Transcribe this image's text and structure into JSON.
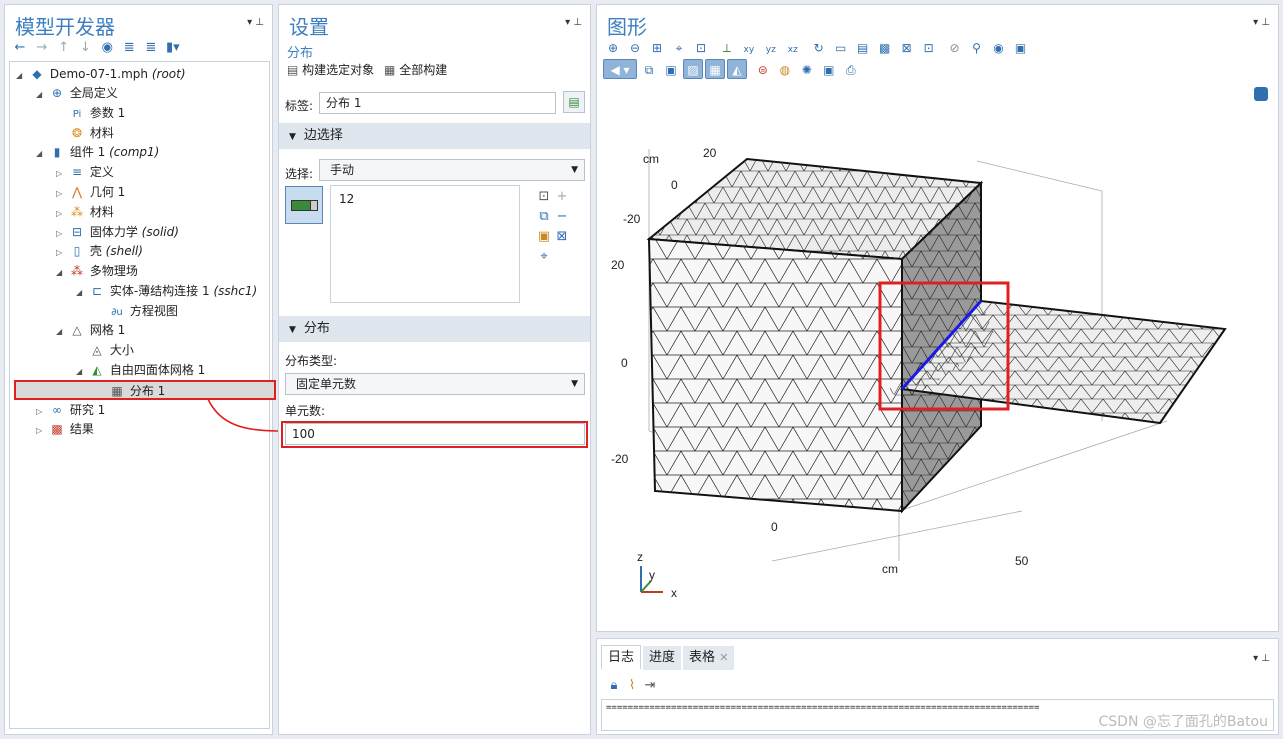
{
  "model_builder": {
    "title": "模型开发器",
    "tree": [
      {
        "label": "Demo-07-1.mph",
        "suffix": "(root)"
      },
      {
        "label": "全局定义"
      },
      {
        "label": "参数 1"
      },
      {
        "label": "材料"
      },
      {
        "label": "组件 1",
        "suffix": "(comp1)"
      },
      {
        "label": "定义"
      },
      {
        "label": "几何 1"
      },
      {
        "label": "材料"
      },
      {
        "label": "固体力学",
        "suffix": "(solid)"
      },
      {
        "label": "壳",
        "suffix": "(shell)"
      },
      {
        "label": "多物理场"
      },
      {
        "label": "实体-薄结构连接 1",
        "suffix": "(sshc1)"
      },
      {
        "label": "方程视图"
      },
      {
        "label": "网格 1"
      },
      {
        "label": "大小"
      },
      {
        "label": "自由四面体网格 1"
      },
      {
        "label": "分布 1"
      },
      {
        "label": "研究 1"
      },
      {
        "label": "结果"
      }
    ]
  },
  "settings": {
    "title": "设置",
    "subtitle": "分布",
    "build_selected": "构建选定对象",
    "build_all": "全部构建",
    "label_caption": "标签:",
    "label_value": "分布 1",
    "edge_section": "边选择",
    "selection_caption": "选择:",
    "selection_value": "手动",
    "selected_item": "12",
    "dist_section": "分布",
    "dist_type_caption": "分布类型:",
    "dist_type_value": "固定单元数",
    "elements_caption": "单元数:",
    "elements_value": "100"
  },
  "graphics": {
    "title": "图形",
    "axis_labels": {
      "cm_top": "cm",
      "y20": "20",
      "y0": "0",
      "ym20": "-20",
      "z20": "20",
      "z0": "0",
      "zm20": "-20",
      "x0": "0",
      "cm_bottom": "cm",
      "x50": "50"
    },
    "triad": {
      "z": "z",
      "y": "y",
      "x": "x"
    }
  },
  "log": {
    "tabs": [
      "日志",
      "进度",
      "表格"
    ],
    "content": "================================================================================",
    "watermark": "CSDN @忘了面孔的Batou"
  }
}
